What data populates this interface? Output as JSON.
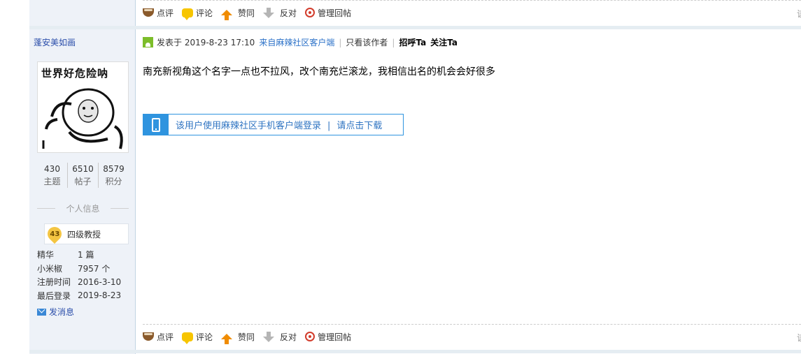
{
  "actions": {
    "comment": "点评",
    "reply": "评论",
    "support": "赞同",
    "oppose": "反对",
    "manage": "管理回帖",
    "edge": "该"
  },
  "user": {
    "name": "蓬安美如画",
    "avatar_caption": "世界好危险呐",
    "stats": [
      {
        "value": "430",
        "label": "主题"
      },
      {
        "value": "6510",
        "label": "帖子"
      },
      {
        "value": "8579",
        "label": "积分"
      }
    ],
    "info_heading": "个人信息",
    "rank_level": "43",
    "rank_name": "四级教授",
    "profile": [
      {
        "key": "精华",
        "value": "1 篇"
      },
      {
        "key": "小米椒",
        "value": "7957 个"
      },
      {
        "key": "注册时间",
        "value": "2016-3-10"
      },
      {
        "key": "最后登录",
        "value": "2019-8-23"
      }
    ],
    "send_message": "发消息"
  },
  "post": {
    "posted_at": "发表于 2019-8-23 17:10",
    "source": "来自麻辣社区客户端",
    "only_author": "只看该作者",
    "greet": "招呼Ta",
    "follow": "关注Ta",
    "content": "南充新视角这个名字一点也不拉风，改个南充烂滚龙，我相信出名的机会会好很多",
    "mobile_tip": "该用户使用麻辣社区手机客户端登录",
    "mobile_sep": "|",
    "mobile_download": "请点击下载"
  }
}
